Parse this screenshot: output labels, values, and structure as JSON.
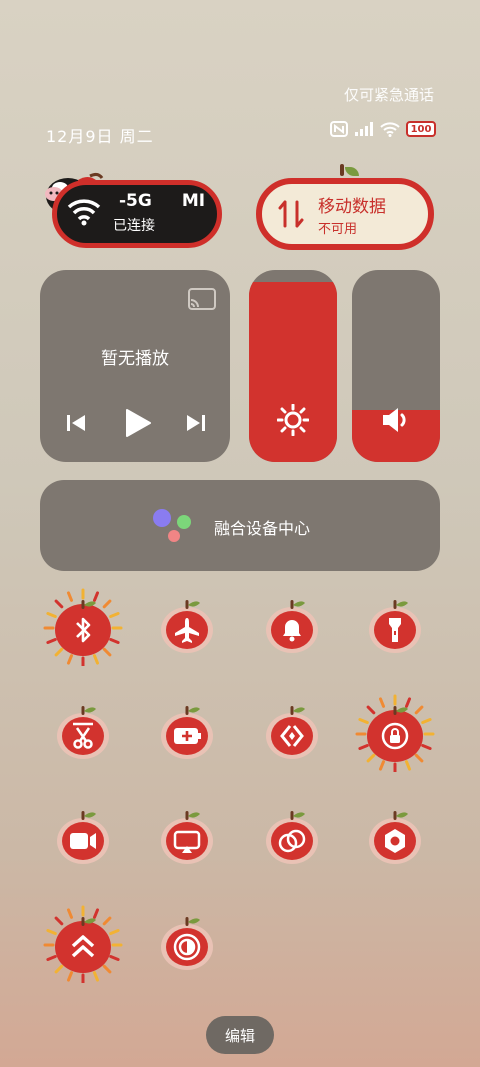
{
  "status_bar": {
    "emergency_text": "仅可紧急通话",
    "date": "12月9日 周二",
    "battery": "100"
  },
  "wifi_tile": {
    "ssid": "-5G",
    "ssid_extra": "MI",
    "status": "已连接"
  },
  "mobile_tile": {
    "title": "移动数据",
    "status": "不可用"
  },
  "media": {
    "title": "暂无播放"
  },
  "brightness": {
    "level": 0.94
  },
  "volume": {
    "level": 0.27
  },
  "device_center": {
    "label": "融合设备中心"
  },
  "toggles": [
    {
      "name": "bluetooth",
      "icon": "bluetooth-icon",
      "active": true
    },
    {
      "name": "airplane",
      "icon": "airplane-icon",
      "active": false
    },
    {
      "name": "ring",
      "icon": "bell-icon",
      "active": false
    },
    {
      "name": "flashlight",
      "icon": "flashlight-icon",
      "active": false
    },
    {
      "name": "screenshot",
      "icon": "scissors-icon",
      "active": false
    },
    {
      "name": "battery-saver",
      "icon": "battery-plus-icon",
      "active": false
    },
    {
      "name": "share",
      "icon": "share-icon",
      "active": false
    },
    {
      "name": "rotation-lock",
      "icon": "rotation-lock-icon",
      "active": true
    },
    {
      "name": "screen-record",
      "icon": "video-icon",
      "active": false
    },
    {
      "name": "cast",
      "icon": "cast-screen-icon",
      "active": false
    },
    {
      "name": "link",
      "icon": "link-icon",
      "active": false
    },
    {
      "name": "settings",
      "icon": "hexagon-icon",
      "active": false
    },
    {
      "name": "performance",
      "icon": "double-chevron-up-icon",
      "active": true
    },
    {
      "name": "dark-mode",
      "icon": "contrast-icon",
      "active": false
    }
  ],
  "edit_label": "编辑",
  "colors": {
    "accent_red": "#d2332e",
    "panel_gray": "#7e7770",
    "cream": "#f3ead7"
  }
}
